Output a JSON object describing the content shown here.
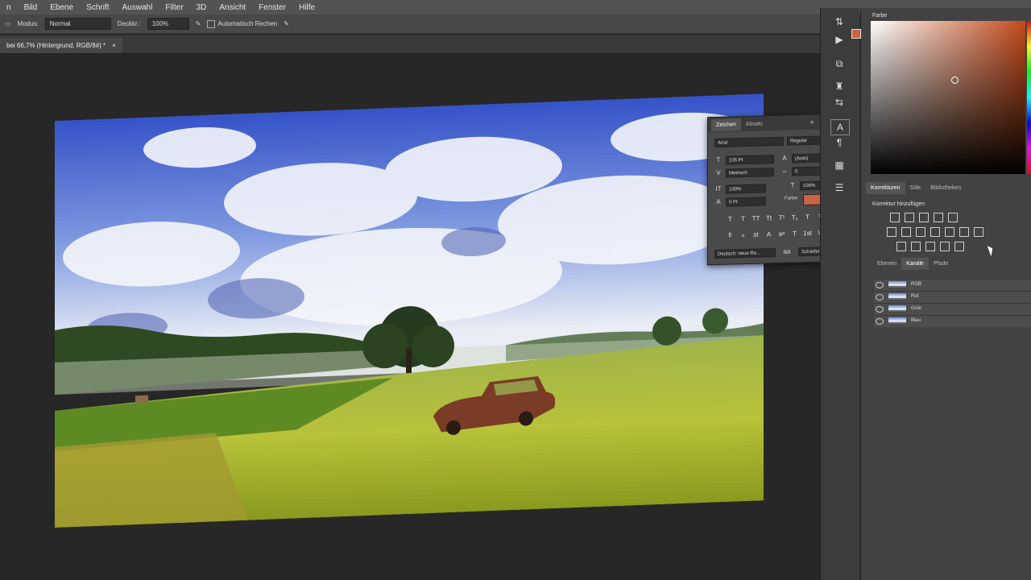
{
  "menu": [
    "n",
    "Bild",
    "Ebene",
    "Schrift",
    "Auswahl",
    "Filter",
    "3D",
    "Ansicht",
    "Fenster",
    "Hilfe"
  ],
  "options": {
    "modus_label": "Modus:",
    "modus_value": "Normal",
    "deckkr_label": "Deckkr.:",
    "deckkr_value": "100%",
    "auto_label": "Automatisch Rechen"
  },
  "document": {
    "tab_title": "bei 66,7% (Hintergrund, RGB/8#) *",
    "close": "×"
  },
  "color_panel": {
    "title": "Farbe"
  },
  "adjust_panel": {
    "tabs": [
      "Korrekturen",
      "Stile",
      "Bibliotheken"
    ],
    "subtitle": "Korrektur hinzufügen"
  },
  "layers_panel": {
    "tabs": [
      "Ebenen",
      "Kanäle",
      "Pfade"
    ],
    "channels": [
      "RGB",
      "Rot",
      "Grün",
      "Blau"
    ]
  },
  "char_panel": {
    "tabs": [
      "Zeichen",
      "Absatz"
    ],
    "font": "Arial",
    "style": "Regular",
    "size": "105 Pt",
    "leading": "(Auto)",
    "kerning": "Metrisch",
    "tracking": "0",
    "vscale": "100%",
    "hscale": "100%",
    "baseline": "0 Pt",
    "color_label": "Farbe:",
    "language": "Deutsch: neue Re...",
    "aa_label": "aa",
    "antialias": "Schärfer"
  },
  "colors": {
    "foreground": "#c86446",
    "accent": "#c24a1c"
  }
}
